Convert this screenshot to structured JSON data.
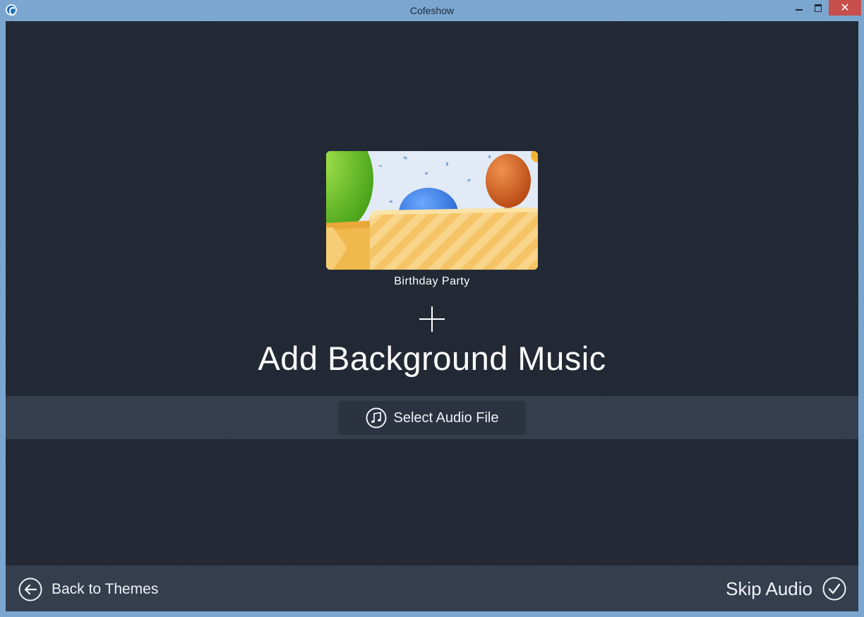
{
  "window": {
    "title": "Cofeshow",
    "close_glyph": "✕"
  },
  "theme": {
    "name": "Birthday Party"
  },
  "main": {
    "heading": "Add Background Music",
    "select_audio_label": "Select Audio File"
  },
  "footer": {
    "back_label": "Back to Themes",
    "skip_label": "Skip Audio"
  },
  "colors": {
    "background": "#222935",
    "band": "#353e4d",
    "button": "#2b3341",
    "close_button": "#c74f4b",
    "window_frame": "#7ba6cf"
  },
  "icons": [
    "app-icon",
    "minimize-icon",
    "maximize-icon",
    "close-icon",
    "plus-icon",
    "music-note-icon",
    "back-arrow-icon",
    "checkmark-icon"
  ]
}
